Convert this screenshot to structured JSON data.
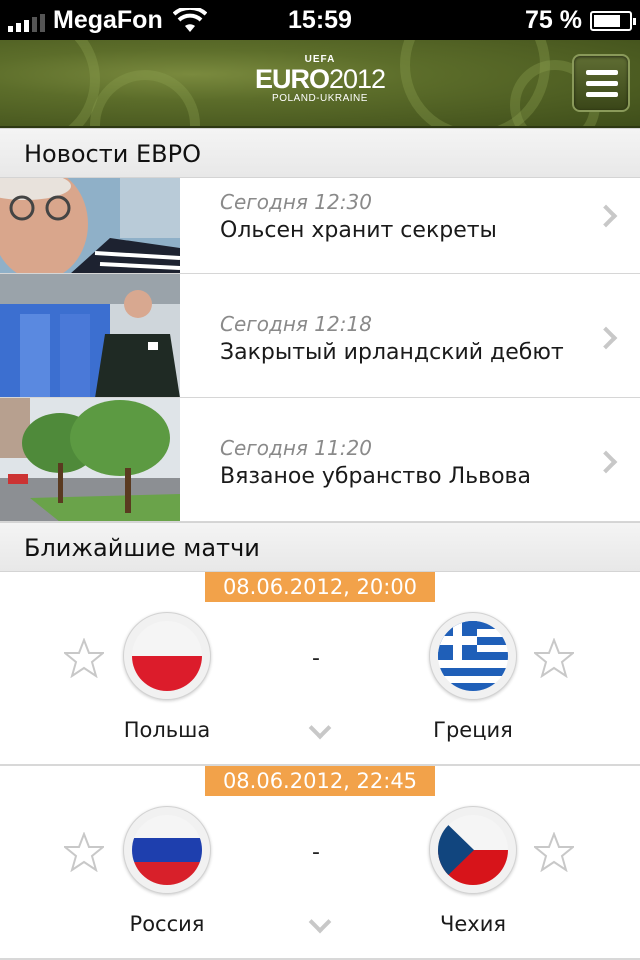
{
  "status_bar": {
    "carrier": "MegaFon",
    "time": "15:59",
    "battery": "75 %",
    "battery_level": 0.75
  },
  "header": {
    "logo_uefa": "UEFA",
    "logo_euro": "EURO",
    "logo_year": "2012",
    "logo_sub": "POLAND-UKRAINE",
    "menu_icon": "hamburger-menu-icon"
  },
  "news_section": {
    "title": "Новости ЕВРО",
    "items": [
      {
        "time": "Сегодня 12:30",
        "title": "Ольсен хранит секреты"
      },
      {
        "time": "Сегодня 12:18",
        "title": "Закрытый ирландский дебют"
      },
      {
        "time": "Сегодня 11:20",
        "title": "Вязаное убранство Львова"
      }
    ]
  },
  "matches_section": {
    "title": "Ближайшие матчи",
    "matches": [
      {
        "date": "08.06.2012, 20:00",
        "home": "Польша",
        "away": "Греция",
        "score": "-"
      },
      {
        "date": "08.06.2012, 22:45",
        "home": "Россия",
        "away": "Чехия",
        "score": "-"
      }
    ]
  },
  "colors": {
    "accent_orange": "#f2a24a",
    "header_green": "#5c6d2a"
  }
}
